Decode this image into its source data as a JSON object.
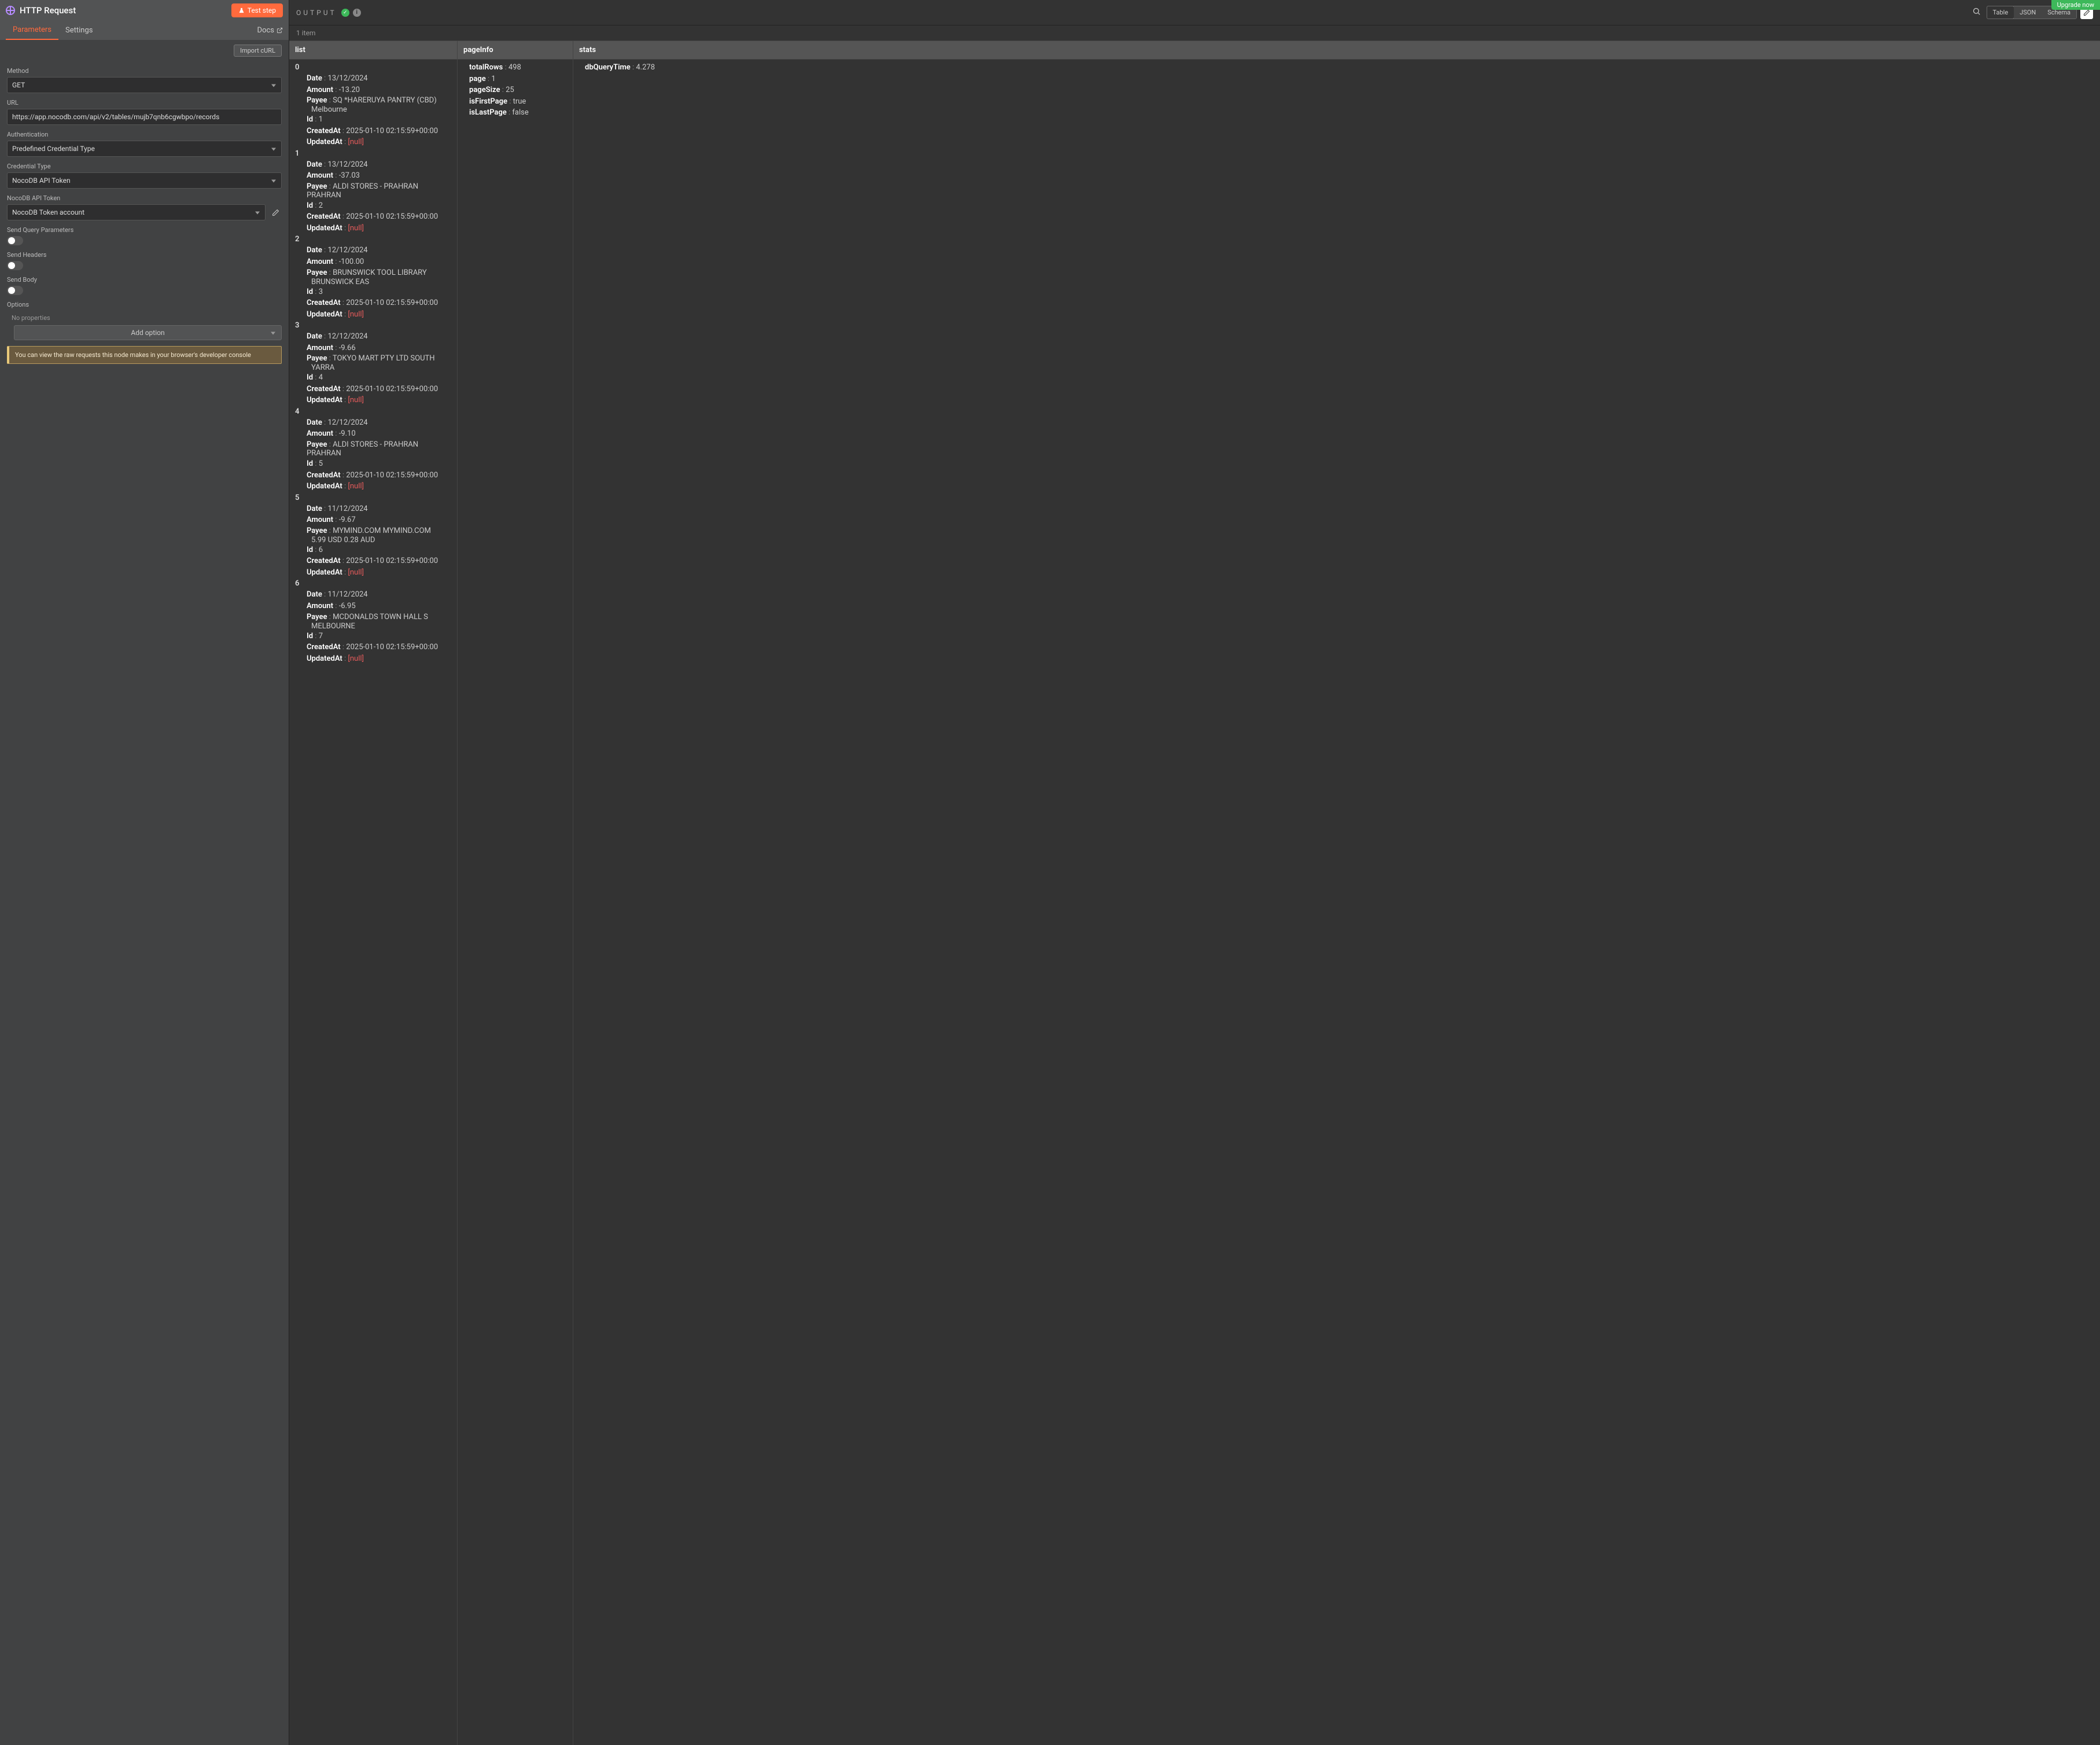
{
  "banner": "Upgrade now",
  "panel": {
    "title": "HTTP Request",
    "test_label": "Test step",
    "tabs": {
      "parameters": "Parameters",
      "settings": "Settings"
    },
    "docs": "Docs",
    "import": "Import cURL"
  },
  "form": {
    "method_label": "Method",
    "method_value": "GET",
    "url_label": "URL",
    "url_value": "https://app.nocodb.com/api/v2/tables/mujb7qnb6cgwbpo/records",
    "auth_label": "Authentication",
    "auth_value": "Predefined Credential Type",
    "credtype_label": "Credential Type",
    "credtype_value": "NocoDB API Token",
    "token_label": "NocoDB API Token",
    "token_value": "NocoDB Token account",
    "query_label": "Send Query Parameters",
    "headers_label": "Send Headers",
    "body_label": "Send Body",
    "options_label": "Options",
    "no_props": "No properties",
    "add_option": "Add option",
    "info_msg": "You can view the raw requests this node makes in your browser's developer console"
  },
  "output": {
    "title": "OUTPUT",
    "views": {
      "table": "Table",
      "json": "JSON",
      "schema": "Schema"
    },
    "item_count": "1 item",
    "headers": {
      "list": "list",
      "pageInfo": "pageInfo",
      "stats": "stats"
    }
  },
  "pageInfo": [
    {
      "k": "totalRows",
      "v": "498"
    },
    {
      "k": "page",
      "v": "1"
    },
    {
      "k": "pageSize",
      "v": "25"
    },
    {
      "k": "isFirstPage",
      "v": "true"
    },
    {
      "k": "isLastPage",
      "v": "false"
    }
  ],
  "stats": [
    {
      "k": "dbQueryTime",
      "v": "4.278"
    }
  ],
  "list": [
    {
      "Date": "13/12/2024",
      "Amount": "-13.20",
      "Payee": "SQ *HARERUYA PANTRY (CBD)",
      "PayeeCont": "Melbourne",
      "Id": "1",
      "CreatedAt": "2025-01-10 02:15:59+00:00",
      "UpdatedAt": "[null]"
    },
    {
      "Date": "13/12/2024",
      "Amount": "-37.03",
      "Payee": "ALDI STORES - PRAHRAN     PRAHRAN",
      "PayeeCont": "",
      "Id": "2",
      "CreatedAt": "2025-01-10 02:15:59+00:00",
      "UpdatedAt": "[null]"
    },
    {
      "Date": "12/12/2024",
      "Amount": "-100.00",
      "Payee": "BRUNSWICK TOOL LIBRARY",
      "PayeeCont": "BRUNSWICK EAS",
      "Id": "3",
      "CreatedAt": "2025-01-10 02:15:59+00:00",
      "UpdatedAt": "[null]"
    },
    {
      "Date": "12/12/2024",
      "Amount": "-9.66",
      "Payee": "TOKYO MART PTY LTD        SOUTH",
      "PayeeCont": "YARRA",
      "Id": "4",
      "CreatedAt": "2025-01-10 02:15:59+00:00",
      "UpdatedAt": "[null]"
    },
    {
      "Date": "12/12/2024",
      "Amount": "-9.10",
      "Payee": "ALDI STORES - PRAHRAN     PRAHRAN",
      "PayeeCont": "",
      "Id": "5",
      "CreatedAt": "2025-01-10 02:15:59+00:00",
      "UpdatedAt": "[null]"
    },
    {
      "Date": "11/12/2024",
      "Amount": "-9.67",
      "Payee": "MYMIND.COM                MYMIND.COM",
      "PayeeCont": "5.99  USD 0.28 AUD",
      "Id": "6",
      "CreatedAt": "2025-01-10 02:15:59+00:00",
      "UpdatedAt": "[null]"
    },
    {
      "Date": "11/12/2024",
      "Amount": "-6.95",
      "Payee": "MCDONALDS TOWN HALL S",
      "PayeeCont": "MELBOURNE",
      "Id": "7",
      "CreatedAt": "2025-01-10 02:15:59+00:00",
      "UpdatedAt": "[null]"
    }
  ]
}
